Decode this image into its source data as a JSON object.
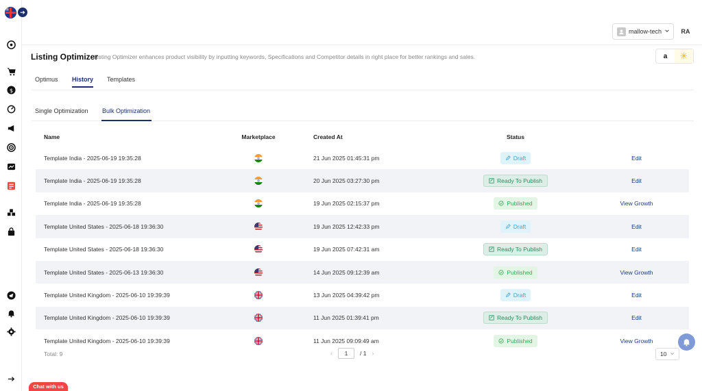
{
  "header": {
    "title": "Listing Optimizer",
    "description": "Listing Optimizer enhances product visibility by inputting keywords, Specifications and Competitor details in right place for better rankings and sales."
  },
  "account": {
    "name": "mallow-tech",
    "initials": "RA"
  },
  "marketplaces": {
    "amazon": "a",
    "walmart": "✳"
  },
  "tabs": [
    {
      "label": "Optimus"
    },
    {
      "label": "History"
    },
    {
      "label": "Templates"
    }
  ],
  "subtabs": [
    {
      "label": "Single Optimization"
    },
    {
      "label": "Bulk Optimization"
    }
  ],
  "table": {
    "headers": {
      "name": "Name",
      "marketplace": "Marketplace",
      "created_at": "Created At",
      "status": "Status"
    },
    "rows": [
      {
        "name": "Template India - 2025-06-19 19:35:28",
        "flag": "india",
        "created": "21 Jun 2025 01:45:31 pm",
        "status": "Draft",
        "action": "Edit"
      },
      {
        "name": "Template India - 2025-06-19 19:35:28",
        "flag": "india",
        "created": "20 Jun 2025 03:27:30 pm",
        "status": "Ready To Publish",
        "action": "Edit"
      },
      {
        "name": "Template India - 2025-06-19 19:35:28",
        "flag": "india",
        "created": "19 Jun 2025 02:15:37 pm",
        "status": "Published",
        "action": "View Growth"
      },
      {
        "name": "Template United States - 2025-06-18 19:36:30",
        "flag": "us",
        "created": "19 Jun 2025 12:42:33 pm",
        "status": "Draft",
        "action": "Edit"
      },
      {
        "name": "Template United States - 2025-06-18 19:36:30",
        "flag": "us",
        "created": "19 Jun 2025 07:42:31 am",
        "status": "Ready To Publish",
        "action": "Edit"
      },
      {
        "name": "Template United States - 2025-06-13 19:36:30",
        "flag": "us",
        "created": "14 Jun 2025 09:12:39 am",
        "status": "Published",
        "action": "View Growth"
      },
      {
        "name": "Template United Kingdom - 2025-06-10 19:39:39",
        "flag": "uk",
        "created": "13 Jun 2025 04:39:42 pm",
        "status": "Draft",
        "action": "Edit"
      },
      {
        "name": "Template United Kingdom - 2025-06-10 19:39:39",
        "flag": "uk",
        "created": "11 Jun 2025 01:39:41 pm",
        "status": "Ready To Publish",
        "action": "Edit"
      },
      {
        "name": "Template United Kingdom - 2025-06-10 19:39:39",
        "flag": "uk",
        "created": "11 Jun 2025 09:09:49 am",
        "status": "Published",
        "action": "View Growth"
      }
    ]
  },
  "footer": {
    "total": "Total: 9",
    "page": "1",
    "page_of": "/ 1",
    "per_page": "10"
  },
  "chat": {
    "label": "Chat with us"
  }
}
